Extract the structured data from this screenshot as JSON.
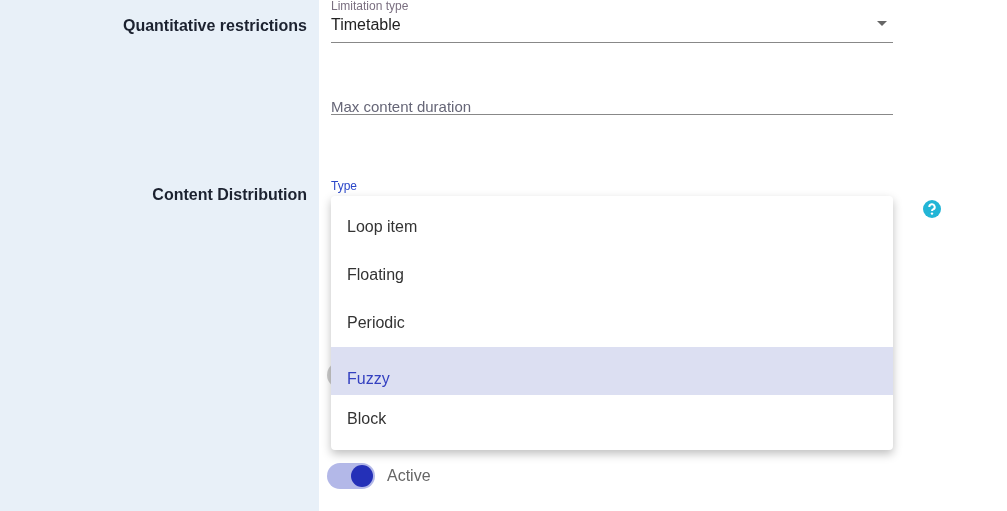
{
  "sections": [
    {
      "label": "Quantitative restrictions",
      "fields": [
        {
          "kind": "select",
          "label": "Limitation type",
          "value": "Timetable"
        },
        {
          "kind": "text",
          "placeholder": "Max content duration"
        }
      ]
    },
    {
      "label": "Content Distribution",
      "fields": [
        {
          "kind": "select",
          "label": "Type",
          "focused": true,
          "help": true
        }
      ]
    }
  ],
  "menu": {
    "items": [
      {
        "label": "Loop item",
        "selected": false
      },
      {
        "label": "Floating",
        "selected": false
      },
      {
        "label": "Periodic",
        "selected": false
      },
      {
        "label": "Fuzzy",
        "selected": true
      },
      {
        "label": "Block",
        "selected": false
      }
    ]
  },
  "toggle": {
    "label": "Active",
    "on": true
  }
}
